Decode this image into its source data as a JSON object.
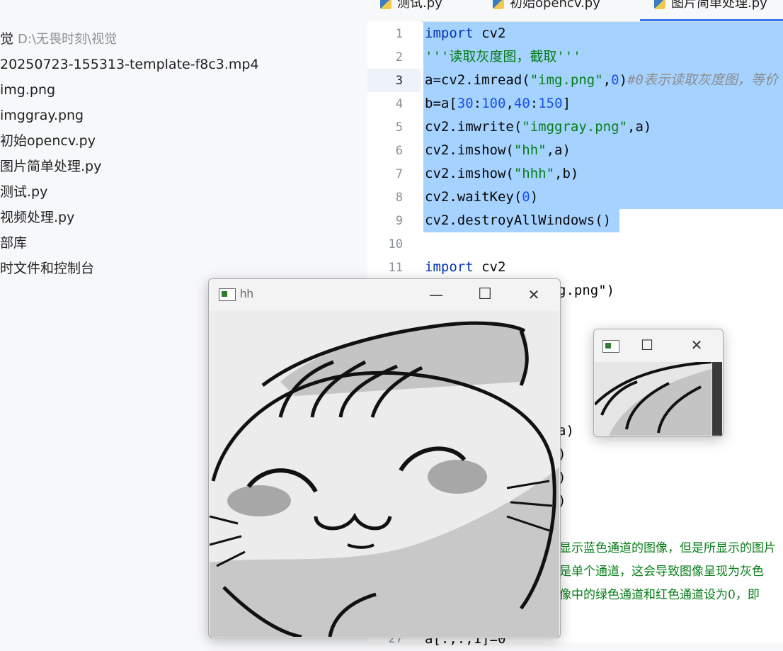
{
  "project_tree": {
    "root_name": "觉",
    "root_path": "D:\\无畏时刻\\视觉",
    "items": [
      {
        "label": "20250723-155313-template-f8c3.mp4"
      },
      {
        "label": "img.png"
      },
      {
        "label": "imggray.png"
      },
      {
        "label": "初始opencv.py"
      },
      {
        "label": "图片简单处理.py"
      },
      {
        "label": "测试.py"
      },
      {
        "label": "视频处理.py"
      },
      {
        "label": "部库"
      },
      {
        "label": "时文件和控制台"
      }
    ]
  },
  "tabs": [
    {
      "label": "测试.py"
    },
    {
      "label": "初始opencv.py"
    },
    {
      "label": "图片简单处理.py",
      "active": true
    }
  ],
  "editor": {
    "line_numbers": [
      "1",
      "2",
      "3",
      "4",
      "5",
      "6",
      "7",
      "8",
      "9",
      "10",
      "11",
      "27"
    ],
    "current_line": "3",
    "lines": [
      {
        "no": "1",
        "parts": [
          {
            "t": "import",
            "c": "kw"
          },
          {
            "t": " cv2",
            "c": ""
          }
        ]
      },
      {
        "no": "2",
        "parts": [
          {
            "t": "'''读取灰度图，截取'''",
            "c": "str"
          }
        ]
      },
      {
        "no": "3",
        "parts": [
          {
            "t": "a=cv2.imread(",
            "c": ""
          },
          {
            "t": "\"img.png\"",
            "c": "str"
          },
          {
            "t": ",",
            "c": ""
          },
          {
            "t": "0",
            "c": "num"
          },
          {
            "t": ")",
            "c": ""
          },
          {
            "t": "#0表示读取灰度图，等价",
            "c": "cmt"
          }
        ]
      },
      {
        "no": "4",
        "parts": [
          {
            "t": "b=a[",
            "c": ""
          },
          {
            "t": "30",
            "c": "num"
          },
          {
            "t": ":",
            "c": ""
          },
          {
            "t": "100",
            "c": "num"
          },
          {
            "t": ",",
            "c": ""
          },
          {
            "t": "40",
            "c": "num"
          },
          {
            "t": ":",
            "c": ""
          },
          {
            "t": "150",
            "c": "num"
          },
          {
            "t": "]",
            "c": ""
          }
        ]
      },
      {
        "no": "5",
        "parts": [
          {
            "t": "cv2.imwrite(",
            "c": ""
          },
          {
            "t": "\"imggray.png\"",
            "c": "str"
          },
          {
            "t": ",a)",
            "c": ""
          }
        ]
      },
      {
        "no": "6",
        "parts": [
          {
            "t": "cv2.imshow(",
            "c": ""
          },
          {
            "t": "\"hh\"",
            "c": "str"
          },
          {
            "t": ",a)",
            "c": ""
          }
        ]
      },
      {
        "no": "7",
        "parts": [
          {
            "t": "cv2.imshow(",
            "c": ""
          },
          {
            "t": "\"hhh\"",
            "c": "str"
          },
          {
            "t": ",b)",
            "c": ""
          }
        ]
      },
      {
        "no": "8",
        "parts": [
          {
            "t": "cv2.waitKey(",
            "c": ""
          },
          {
            "t": "0",
            "c": "num"
          },
          {
            "t": ")",
            "c": ""
          }
        ]
      },
      {
        "no": "9",
        "parts": [
          {
            "t": "cv2.destroyAllWindows()",
            "c": ""
          }
        ]
      },
      {
        "no": "10",
        "parts": []
      },
      {
        "no": "11",
        "parts": [
          {
            "t": "import",
            "c": "kw"
          },
          {
            "t": " cv2",
            "c": ""
          }
        ]
      }
    ],
    "peek_lines": [
      {
        "text": "g.png\")"
      },
      {
        "text": "a)"
      },
      {
        "text": ")"
      },
      {
        "text": ")"
      },
      {
        "text": ")"
      },
      {
        "text": "显示蓝色通道的图像，但是所显示的图片"
      },
      {
        "text": "是单个通道，这会导致图像呈现为灰色"
      },
      {
        "text": "像中的绿色通道和红色通道设为0，即"
      },
      {
        "text": "a[:,:,1]=0"
      }
    ]
  },
  "windows": {
    "hh": {
      "title": "hh"
    },
    "hhh": {
      "title": ""
    }
  },
  "window_controls": {
    "minimize": "—",
    "maximize": "☐",
    "close": "✕"
  },
  "colors": {
    "selection": "#a6d2ff",
    "keyword": "#0033b3",
    "string": "#067d17",
    "number": "#1750eb",
    "comment": "#8c8c8c",
    "accent": "#3574f0"
  }
}
